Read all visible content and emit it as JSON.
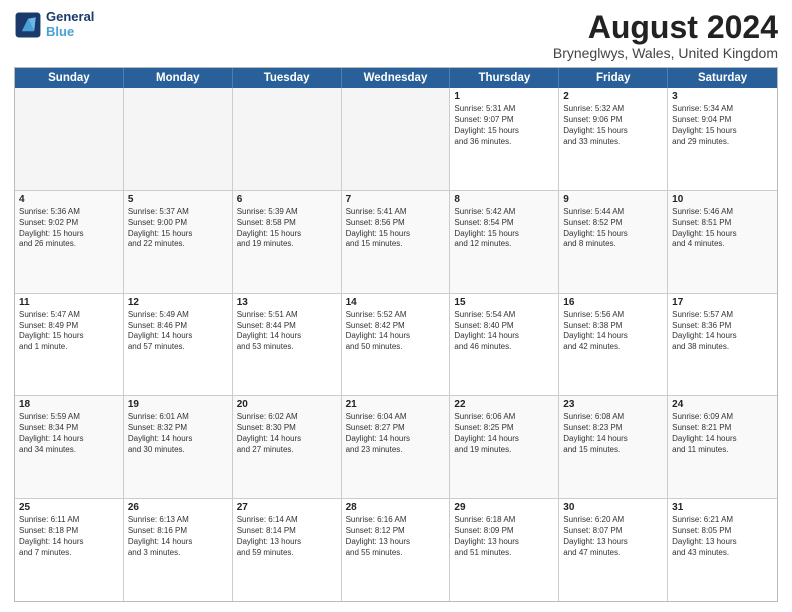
{
  "header": {
    "logo_line1": "General",
    "logo_line2": "Blue",
    "main_title": "August 2024",
    "subtitle": "Bryneglwys, Wales, United Kingdom"
  },
  "days_of_week": [
    "Sunday",
    "Monday",
    "Tuesday",
    "Wednesday",
    "Thursday",
    "Friday",
    "Saturday"
  ],
  "weeks": [
    [
      {
        "day": "",
        "text": "",
        "empty": true
      },
      {
        "day": "",
        "text": "",
        "empty": true
      },
      {
        "day": "",
        "text": "",
        "empty": true
      },
      {
        "day": "",
        "text": "",
        "empty": true
      },
      {
        "day": "1",
        "text": "Sunrise: 5:31 AM\nSunset: 9:07 PM\nDaylight: 15 hours\nand 36 minutes.",
        "empty": false
      },
      {
        "day": "2",
        "text": "Sunrise: 5:32 AM\nSunset: 9:06 PM\nDaylight: 15 hours\nand 33 minutes.",
        "empty": false
      },
      {
        "day": "3",
        "text": "Sunrise: 5:34 AM\nSunset: 9:04 PM\nDaylight: 15 hours\nand 29 minutes.",
        "empty": false
      }
    ],
    [
      {
        "day": "4",
        "text": "Sunrise: 5:36 AM\nSunset: 9:02 PM\nDaylight: 15 hours\nand 26 minutes.",
        "empty": false
      },
      {
        "day": "5",
        "text": "Sunrise: 5:37 AM\nSunset: 9:00 PM\nDaylight: 15 hours\nand 22 minutes.",
        "empty": false
      },
      {
        "day": "6",
        "text": "Sunrise: 5:39 AM\nSunset: 8:58 PM\nDaylight: 15 hours\nand 19 minutes.",
        "empty": false
      },
      {
        "day": "7",
        "text": "Sunrise: 5:41 AM\nSunset: 8:56 PM\nDaylight: 15 hours\nand 15 minutes.",
        "empty": false
      },
      {
        "day": "8",
        "text": "Sunrise: 5:42 AM\nSunset: 8:54 PM\nDaylight: 15 hours\nand 12 minutes.",
        "empty": false
      },
      {
        "day": "9",
        "text": "Sunrise: 5:44 AM\nSunset: 8:52 PM\nDaylight: 15 hours\nand 8 minutes.",
        "empty": false
      },
      {
        "day": "10",
        "text": "Sunrise: 5:46 AM\nSunset: 8:51 PM\nDaylight: 15 hours\nand 4 minutes.",
        "empty": false
      }
    ],
    [
      {
        "day": "11",
        "text": "Sunrise: 5:47 AM\nSunset: 8:49 PM\nDaylight: 15 hours\nand 1 minute.",
        "empty": false
      },
      {
        "day": "12",
        "text": "Sunrise: 5:49 AM\nSunset: 8:46 PM\nDaylight: 14 hours\nand 57 minutes.",
        "empty": false
      },
      {
        "day": "13",
        "text": "Sunrise: 5:51 AM\nSunset: 8:44 PM\nDaylight: 14 hours\nand 53 minutes.",
        "empty": false
      },
      {
        "day": "14",
        "text": "Sunrise: 5:52 AM\nSunset: 8:42 PM\nDaylight: 14 hours\nand 50 minutes.",
        "empty": false
      },
      {
        "day": "15",
        "text": "Sunrise: 5:54 AM\nSunset: 8:40 PM\nDaylight: 14 hours\nand 46 minutes.",
        "empty": false
      },
      {
        "day": "16",
        "text": "Sunrise: 5:56 AM\nSunset: 8:38 PM\nDaylight: 14 hours\nand 42 minutes.",
        "empty": false
      },
      {
        "day": "17",
        "text": "Sunrise: 5:57 AM\nSunset: 8:36 PM\nDaylight: 14 hours\nand 38 minutes.",
        "empty": false
      }
    ],
    [
      {
        "day": "18",
        "text": "Sunrise: 5:59 AM\nSunset: 8:34 PM\nDaylight: 14 hours\nand 34 minutes.",
        "empty": false
      },
      {
        "day": "19",
        "text": "Sunrise: 6:01 AM\nSunset: 8:32 PM\nDaylight: 14 hours\nand 30 minutes.",
        "empty": false
      },
      {
        "day": "20",
        "text": "Sunrise: 6:02 AM\nSunset: 8:30 PM\nDaylight: 14 hours\nand 27 minutes.",
        "empty": false
      },
      {
        "day": "21",
        "text": "Sunrise: 6:04 AM\nSunset: 8:27 PM\nDaylight: 14 hours\nand 23 minutes.",
        "empty": false
      },
      {
        "day": "22",
        "text": "Sunrise: 6:06 AM\nSunset: 8:25 PM\nDaylight: 14 hours\nand 19 minutes.",
        "empty": false
      },
      {
        "day": "23",
        "text": "Sunrise: 6:08 AM\nSunset: 8:23 PM\nDaylight: 14 hours\nand 15 minutes.",
        "empty": false
      },
      {
        "day": "24",
        "text": "Sunrise: 6:09 AM\nSunset: 8:21 PM\nDaylight: 14 hours\nand 11 minutes.",
        "empty": false
      }
    ],
    [
      {
        "day": "25",
        "text": "Sunrise: 6:11 AM\nSunset: 8:18 PM\nDaylight: 14 hours\nand 7 minutes.",
        "empty": false
      },
      {
        "day": "26",
        "text": "Sunrise: 6:13 AM\nSunset: 8:16 PM\nDaylight: 14 hours\nand 3 minutes.",
        "empty": false
      },
      {
        "day": "27",
        "text": "Sunrise: 6:14 AM\nSunset: 8:14 PM\nDaylight: 13 hours\nand 59 minutes.",
        "empty": false
      },
      {
        "day": "28",
        "text": "Sunrise: 6:16 AM\nSunset: 8:12 PM\nDaylight: 13 hours\nand 55 minutes.",
        "empty": false
      },
      {
        "day": "29",
        "text": "Sunrise: 6:18 AM\nSunset: 8:09 PM\nDaylight: 13 hours\nand 51 minutes.",
        "empty": false
      },
      {
        "day": "30",
        "text": "Sunrise: 6:20 AM\nSunset: 8:07 PM\nDaylight: 13 hours\nand 47 minutes.",
        "empty": false
      },
      {
        "day": "31",
        "text": "Sunrise: 6:21 AM\nSunset: 8:05 PM\nDaylight: 13 hours\nand 43 minutes.",
        "empty": false
      }
    ]
  ]
}
